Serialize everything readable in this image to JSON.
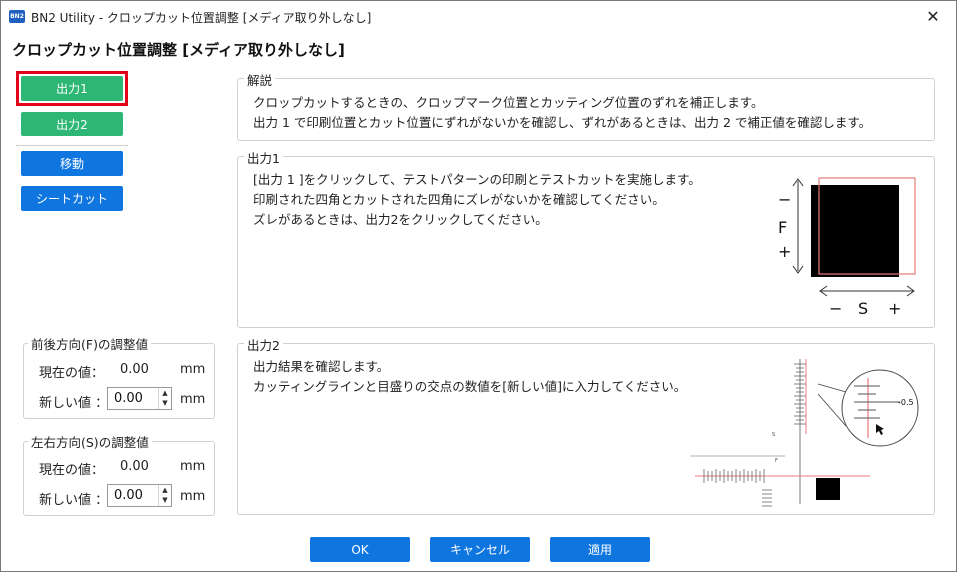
{
  "window": {
    "title": "BN2 Utility - クロップカット位置調整 [メディア取り外しなし]",
    "app_icon_text": "BN2",
    "close_glyph": "✕"
  },
  "heading": "クロップカット位置調整 [メディア取り外しなし]",
  "left_buttons": {
    "output1": "出力1",
    "output2": "出力2",
    "move": "移動",
    "sheet_cut": "シートカット"
  },
  "f_adjust": {
    "title": "前後方向(F)の調整値",
    "current_label": "現在の値：",
    "current_value": "0.00",
    "current_unit": "mm",
    "new_label": "新しい値 ：",
    "new_value": "0.00",
    "new_unit": "mm"
  },
  "s_adjust": {
    "title": "左右方向(S)の調整値",
    "current_label": "現在の値：",
    "current_value": "0.00",
    "current_unit": "mm",
    "new_label": "新しい値 ：",
    "new_value": "0.00",
    "new_unit": "mm"
  },
  "explanation": {
    "title": "解説",
    "line1": "クロップカットするときの、クロップマーク位置とカッティング位置のずれを補正します。",
    "line2": "出力 1 で印刷位置とカット位置にずれがないかを確認し、ずれがあるときは、出力 2 で補正値を確認します。"
  },
  "output1_panel": {
    "title": "出力1",
    "line1": "[出力 1 ]をクリックして、テストパターンの印刷とテストカットを実施します。",
    "line2": "印刷された四角とカットされた四角にズレがないかを確認してください。",
    "line3": "ズレがあるときは、出力2をクリックしてください。",
    "diagram": {
      "minus_f": "−",
      "f_label": "F",
      "plus_f": "+",
      "minus_s": "−",
      "s_label": "S",
      "plus_s": "+"
    }
  },
  "output2_panel": {
    "title": "出力2",
    "line1": "出力結果を確認します。",
    "line2": "カッティングラインと目盛りの交点の数値を[新しい値]に入力してください。",
    "diagram": {
      "zoom_value": "-0.5",
      "f_mark": "F",
      "s_mark": "S"
    }
  },
  "footer": {
    "ok": "OK",
    "cancel": "キャンセル",
    "apply": "適用"
  },
  "colors": {
    "green": "#2eb774",
    "blue": "#0f76e0",
    "focus_red": "#e3001b",
    "cut_line": "#e87a7a"
  }
}
